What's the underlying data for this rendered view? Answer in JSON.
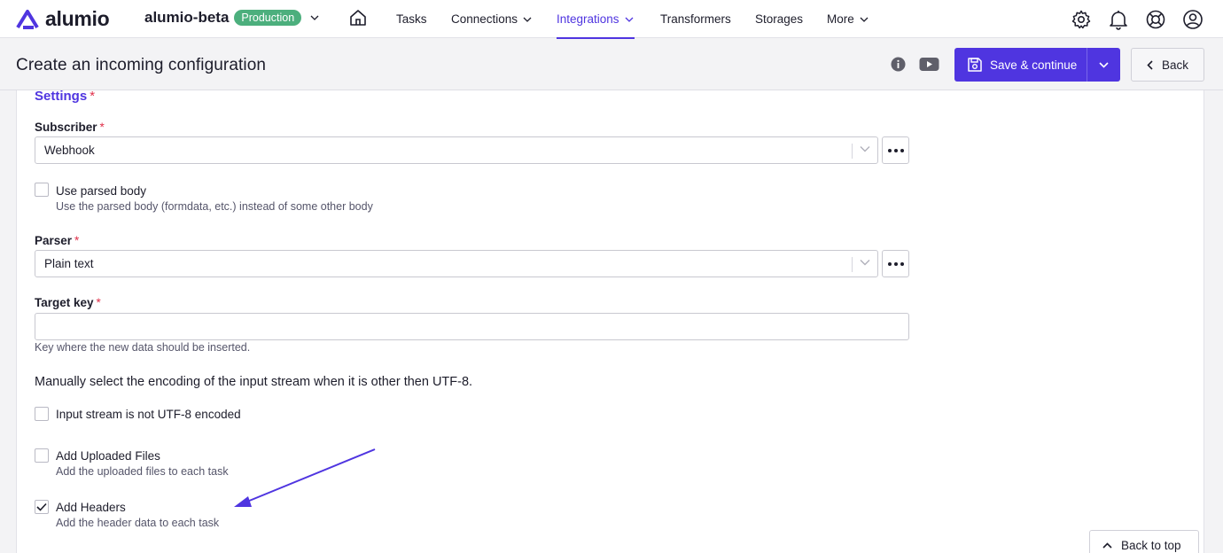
{
  "topnav": {
    "logo_text": "alumio",
    "workspace": "alumio-beta",
    "environment": "Production",
    "items": [
      {
        "label": "Tasks"
      },
      {
        "label": "Connections"
      },
      {
        "label": "Integrations"
      },
      {
        "label": "Transformers"
      },
      {
        "label": "Storages"
      },
      {
        "label": "More"
      }
    ],
    "active_item": "Integrations",
    "icons": [
      "gear-icon",
      "bell-icon",
      "support-icon",
      "user-icon"
    ]
  },
  "header": {
    "title": "Create an incoming configuration",
    "save_label": "Save & continue",
    "back_label": "Back"
  },
  "form": {
    "section_title": "Settings",
    "required_mark": "*",
    "subscriber": {
      "label": "Subscriber",
      "value": "Webhook"
    },
    "use_parsed_body": {
      "label": "Use parsed body",
      "description": "Use the parsed body (formdata, etc.) instead of some other body",
      "checked": false
    },
    "parser": {
      "label": "Parser",
      "value": "Plain text"
    },
    "target_key": {
      "label": "Target key",
      "value": "",
      "help": "Key where the new data should be inserted."
    },
    "encoding_note": "Manually select the encoding of the input stream when it is other then UTF-8.",
    "not_utf8": {
      "label": "Input stream is not UTF-8 encoded",
      "checked": false
    },
    "uploaded_files": {
      "label": "Add Uploaded Files",
      "description": "Add the uploaded files to each task",
      "checked": false
    },
    "headers": {
      "label": "Add Headers",
      "description": "Add the header data to each task",
      "checked": true
    }
  },
  "back_to_top_label": "Back to top",
  "colors": {
    "accent": "#4f35e0",
    "badge": "#4caf7d",
    "required": "#e0304a"
  }
}
